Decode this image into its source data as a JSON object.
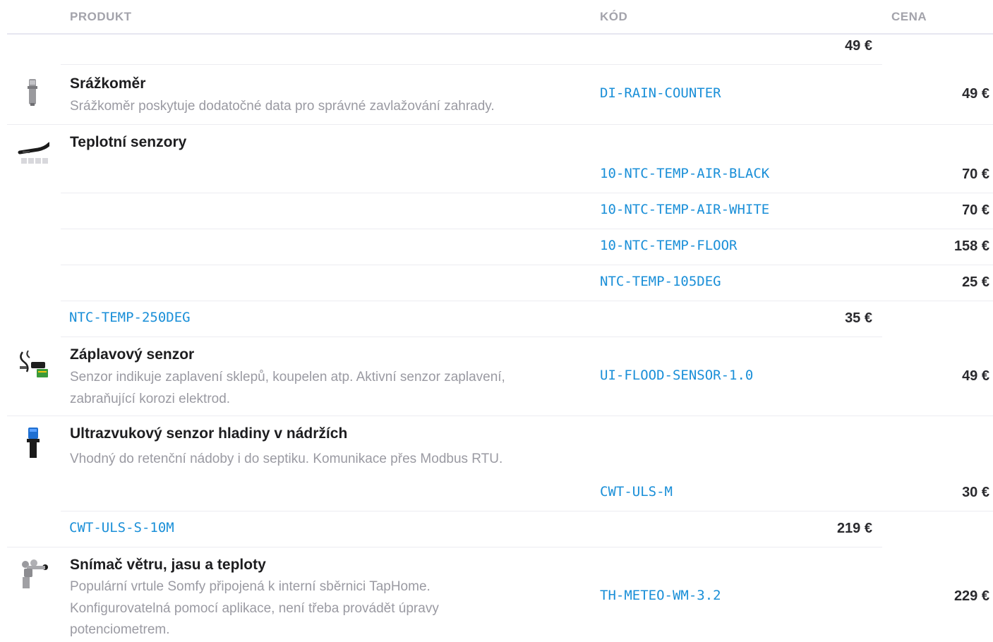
{
  "header": {
    "product": "PRODUKT",
    "code": "KÓD",
    "price": "CENA"
  },
  "stray_rows": [
    {
      "code": "",
      "price": "49 €"
    },
    {
      "code": "NTC-TEMP-250DEG",
      "price": "35 €"
    },
    {
      "code": "CWT-ULS-S-10M",
      "price": "219 €"
    }
  ],
  "products": [
    {
      "name": "Srážkoměr",
      "description": "Srážkoměr poskytuje dodatočné data pro správné zavlažování zahrady.",
      "icon": "rain-gauge-icon",
      "variants": [
        {
          "code": "DI-RAIN-COUNTER",
          "price": "49 €"
        }
      ]
    },
    {
      "name": "Teplotní senzory",
      "description": "",
      "icon": "temperature-sensor-icon",
      "variants": [
        {
          "code": "10-NTC-TEMP-AIR-BLACK",
          "price": "70 €"
        },
        {
          "code": "10-NTC-TEMP-AIR-WHITE",
          "price": "70 €"
        },
        {
          "code": "10-NTC-TEMP-FLOOR",
          "price": "158 €"
        },
        {
          "code": "NTC-TEMP-105DEG",
          "price": "25 €"
        }
      ]
    },
    {
      "name": "Záplavový senzor",
      "description": "Senzor indikuje zaplavení sklepů, koupelen atp. Aktivní senzor zaplavení, zabraňující korozi elektrod.",
      "icon": "flood-sensor-icon",
      "variants": [
        {
          "code": "UI-FLOOD-SENSOR-1.0",
          "price": "49 €"
        }
      ]
    },
    {
      "name": "Ultrazvukový senzor hladiny v nádržích",
      "description": "Vhodný do retenční nádoby i do septiku. Komunikace přes Modbus RTU.",
      "icon": "ultrasonic-sensor-icon",
      "variants": [
        {
          "code": "CWT-ULS-M",
          "price": "30 €"
        }
      ]
    },
    {
      "name": "Snímač větru, jasu a teploty",
      "description": "Populární vrtule Somfy připojená k interní sběrnici TapHome. Konfigurovatelná pomocí aplikace, není třeba provádět úpravy potenciometrem.",
      "icon": "wind-sensor-icon",
      "variants": [
        {
          "code": "TH-METEO-WM-3.2",
          "price": "229 €"
        }
      ]
    }
  ]
}
